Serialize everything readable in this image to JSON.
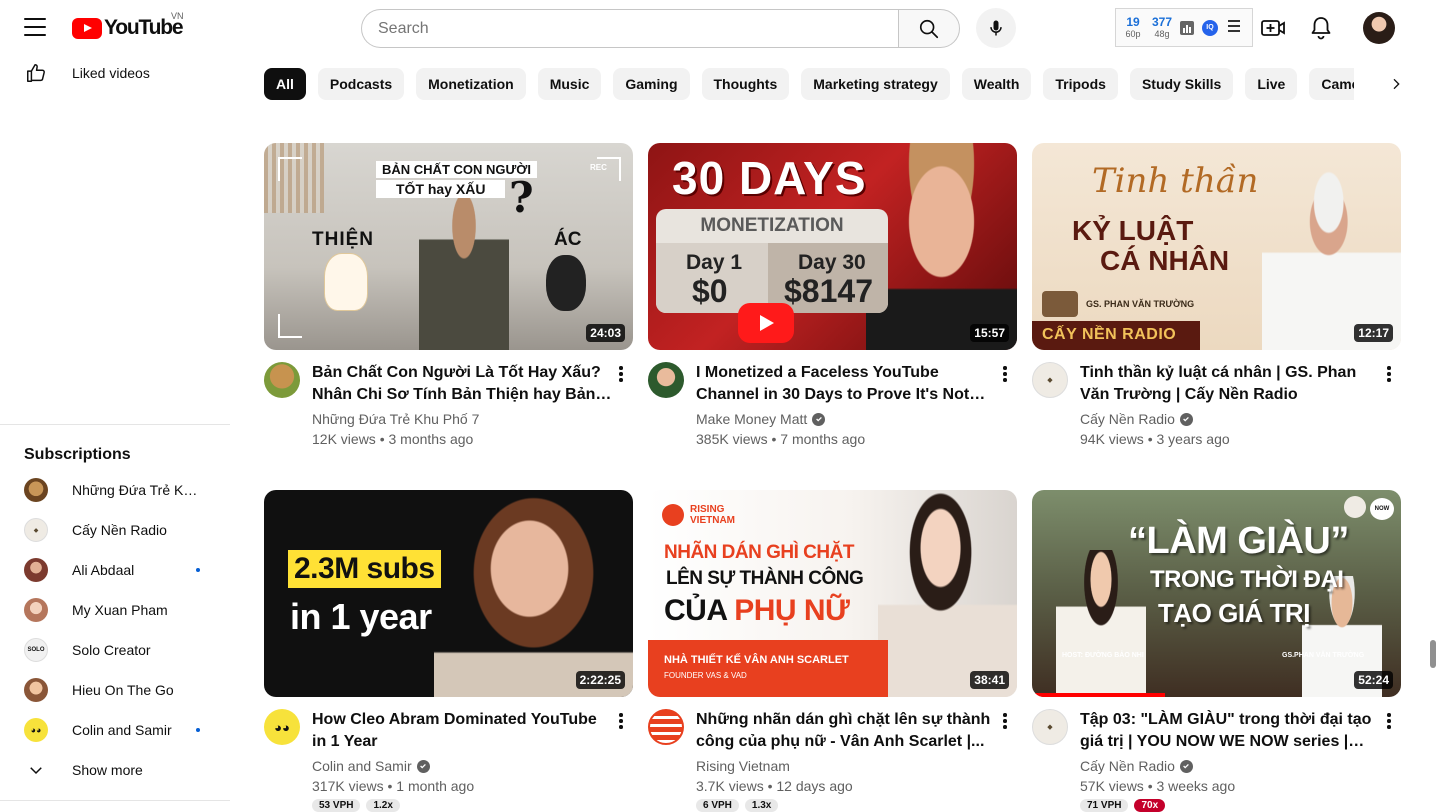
{
  "header": {
    "logo_text": "YouTube",
    "country_code": "VN",
    "search_placeholder": "Search",
    "ext": {
      "stat1_big": "19",
      "stat1_small": "60p",
      "stat2_big": "377",
      "stat2_small": "48g",
      "iq_label": "IQ"
    }
  },
  "sidebar": {
    "liked_label": "Liked videos",
    "subscriptions_heading": "Subscriptions",
    "subscriptions": [
      {
        "name": "Những Đứa Trẻ Khu...",
        "live": false,
        "avatar_color": "#8a5a2b"
      },
      {
        "name": "Cấy Nền Radio",
        "live": false,
        "avatar_color": "#e9e4dc"
      },
      {
        "name": "Ali Abdaal",
        "live": true,
        "avatar_color": "#b84a3a"
      },
      {
        "name": "My Xuan Pham",
        "live": false,
        "avatar_color": "#d9a48a"
      },
      {
        "name": "Solo Creator",
        "live": false,
        "avatar_color": "#f1f1f1"
      },
      {
        "name": "Hieu On The Go",
        "live": false,
        "avatar_color": "#c98f6a"
      },
      {
        "name": "Colin and Samir",
        "live": true,
        "avatar_color": "#f7e23b"
      }
    ],
    "show_more_label": "Show more"
  },
  "chips": [
    "All",
    "Podcasts",
    "Monetization",
    "Music",
    "Gaming",
    "Thoughts",
    "Marketing strategy",
    "Wealth",
    "Tripods",
    "Study Skills",
    "Live",
    "Cameras"
  ],
  "videos": [
    {
      "title": "Bản Chất Con Người Là Tốt Hay Xấu? Nhân Chi Sơ Tính Bản Thiện hay Bản Ác...",
      "channel": "Những Đứa Trẻ Khu Phố 7",
      "verified": false,
      "views": "12K views",
      "age": "3 months ago",
      "duration": "24:03",
      "thumb": {
        "line1": "BẢN CHẤT CON NGƯỜI",
        "line2": "TỐT hay XẤU",
        "left": "THIỆN",
        "right": "ÁC",
        "rec": "REC"
      }
    },
    {
      "title": "I Monetized a Faceless YouTube Channel in 30 Days to Prove It's Not Luck",
      "channel": "Make Money Matt",
      "verified": true,
      "views": "385K views",
      "age": "7 months ago",
      "duration": "15:57",
      "thumb": {
        "headline": "30 DAYS",
        "panel_title": "MONETIZATION",
        "day1": "Day 1",
        "day1_val": "$0",
        "day30": "Day 30",
        "day30_val": "$8147"
      }
    },
    {
      "title": "Tinh thần kỷ luật cá nhân | GS. Phan Văn Trường | Cấy Nền Radio",
      "channel": "Cấy Nền Radio",
      "verified": true,
      "views": "94K views",
      "age": "3 years ago",
      "duration": "12:17",
      "thumb": {
        "script": "Tinh thần",
        "line1": "KỶ LUẬT",
        "line2": "CÁ NHÂN",
        "guest": "GS. PHAN VĂN TRƯỜNG",
        "brand": "CẤY NỀN RADIO"
      }
    },
    {
      "title": "How Cleo Abram Dominated YouTube in 1 Year",
      "channel": "Colin and Samir",
      "verified": true,
      "views": "317K views",
      "age": "1 month ago",
      "duration": "2:22:25",
      "badges": [
        {
          "label": "53 VPH",
          "hot": false
        },
        {
          "label": "1.2x",
          "hot": false
        }
      ],
      "thumb": {
        "line1": "2.3M subs",
        "line2": "in 1 year"
      }
    },
    {
      "title": "Những nhãn dán ghì chặt lên sự thành công của phụ nữ - Vân Anh Scarlet |...",
      "channel": "Rising Vietnam",
      "verified": false,
      "views": "3.7K views",
      "age": "12 days ago",
      "duration": "38:41",
      "badges": [
        {
          "label": "6 VPH",
          "hot": false
        },
        {
          "label": "1.3x",
          "hot": false
        }
      ],
      "thumb": {
        "brand1": "RISING",
        "brand2": "VIETNAM",
        "line1": "NHÃN DÁN GHÌ CHẶT",
        "line2": "LÊN SỰ THÀNH CÔNG",
        "line3a": "CỦA ",
        "line3b": "PHỤ NỮ",
        "caption": "NHÀ THIẾT KẾ VÂN ANH SCARLET",
        "subcaption": "FOUNDER VAS & VAD"
      }
    },
    {
      "title": "Tập 03: \"LÀM GIÀU\" trong thời đại tạo giá trị | YOU NOW WE NOW series | Cấy Nề...",
      "channel": "Cấy Nền Radio",
      "verified": true,
      "views": "57K views",
      "age": "3 weeks ago",
      "duration": "52:24",
      "progress": 0.36,
      "badges": [
        {
          "label": "71 VPH",
          "hot": false
        },
        {
          "label": "70x",
          "hot": true
        }
      ],
      "thumb": {
        "line1": "“LÀM GIÀU”",
        "line2": "TRONG THỜI ĐẠI",
        "line3": "TẠO GIÁ TRỊ",
        "host": "HOST: ĐƯỜNG BẢO NHI",
        "guest": "GS.PHAN VĂN TRƯỜNG",
        "logo": "NOW"
      }
    }
  ],
  "colors": {
    "brand_red": "#ff0000",
    "chip_bg": "#f2f2f2",
    "chip_active": "#0f0f0f",
    "secondary_text": "#606060"
  },
  "icons": [
    "menu-icon",
    "youtube-logo-icon",
    "search-icon",
    "mic-icon",
    "create-icon",
    "bell-icon",
    "thumbs-up-icon",
    "chevron-down-icon",
    "chevron-right-icon",
    "verified-icon",
    "more-vert-icon"
  ]
}
